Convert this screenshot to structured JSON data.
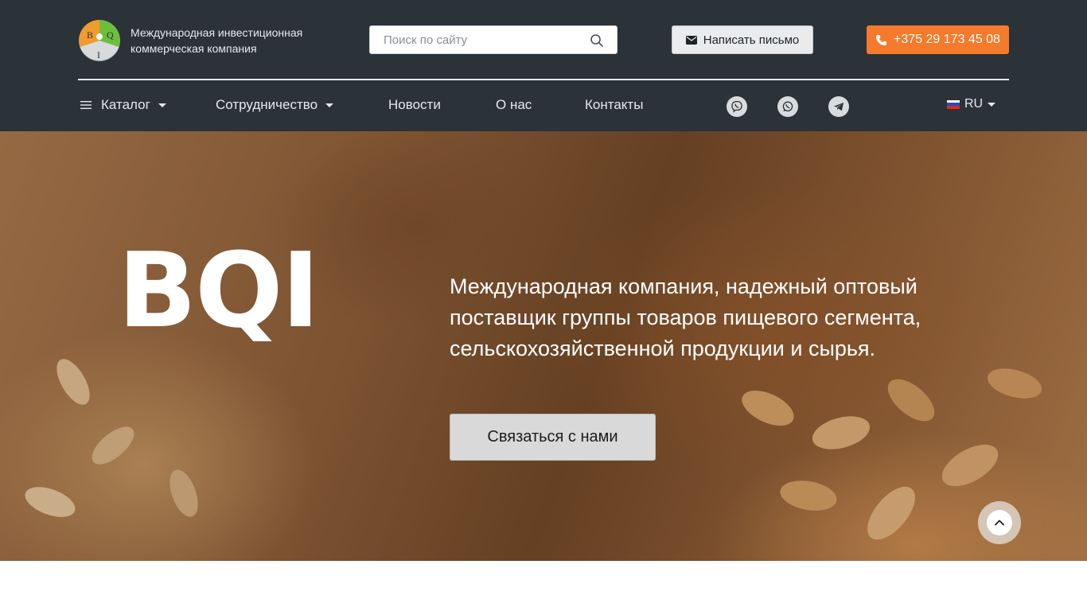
{
  "brand": {
    "logo_letters": [
      "B",
      "Q",
      "I"
    ],
    "tagline_line1": "Международная инвестиционная",
    "tagline_line2": "коммерческая компания"
  },
  "search": {
    "placeholder": "Поиск по сайту",
    "value": ""
  },
  "header_buttons": {
    "mail_label": "Написать письмо",
    "phone_label": "+375 29 173 45 08"
  },
  "nav": {
    "items": [
      {
        "label": "Каталог"
      },
      {
        "label": "Сотрудничество"
      },
      {
        "label": "Новости"
      },
      {
        "label": "О нас"
      },
      {
        "label": "Контакты"
      }
    ],
    "social": [
      "viber-icon",
      "whatsapp-icon",
      "telegram-icon"
    ],
    "language": "RU"
  },
  "hero": {
    "brand": "BQI",
    "text_line1": "Международная компания, надежный оптовый",
    "text_line2": "поставщик группы товаров пищевого сегмента,",
    "text_line3": "сельскохозяйственной продукции и сырья.",
    "cta_label": "Связаться с нами"
  },
  "colors": {
    "header_bg": "#2b3238",
    "accent_orange": "#f57a2b",
    "logo_orange": "#f29a2e",
    "logo_green": "#6cbf3a",
    "logo_grey": "#9aa0a6"
  }
}
